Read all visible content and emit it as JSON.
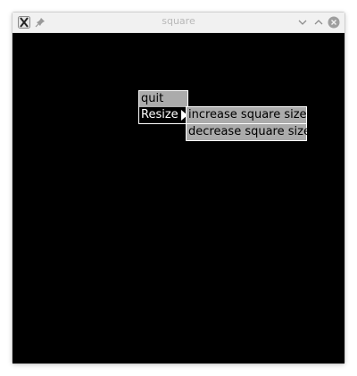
{
  "window": {
    "title": "square"
  },
  "icons": {
    "app": "x11-icon",
    "pin": "pin-icon",
    "minimize": "chevron-down-icon",
    "maximize": "chevron-up-icon",
    "close": "close-icon"
  },
  "colors": {
    "canvas_background": "#000000",
    "menu_item_background": "#ababab",
    "menu_highlight_background": "#000000",
    "menu_highlight_text": "#ffffff",
    "title_text": "#b8b8b8"
  },
  "menu": {
    "items": [
      {
        "label": "quit"
      },
      {
        "label": "Resize",
        "has_submenu": true
      }
    ],
    "highlighted": "Resize"
  },
  "submenu": {
    "items": [
      {
        "label": "increase square size"
      },
      {
        "label": "decrease square size"
      }
    ]
  }
}
